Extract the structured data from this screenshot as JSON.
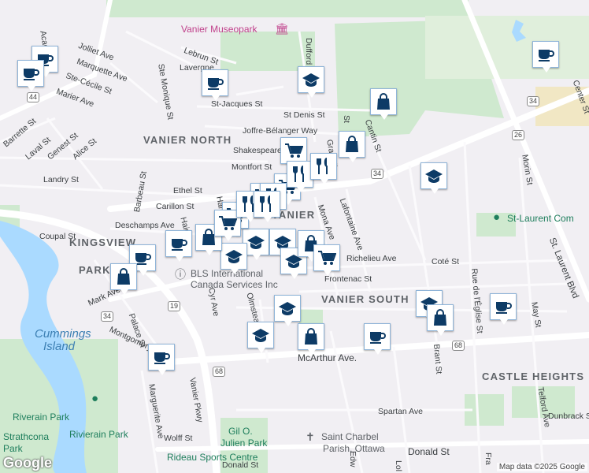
{
  "attribution": {
    "logo": "Google",
    "text": "Map data ©2025 Google"
  },
  "areas": [
    "VANIER NORTH",
    "VANIER",
    "KINGSVIEW",
    "PARK",
    "VANIER SOUTH",
    "CASTLE HEIGHTS"
  ],
  "water_labels": [
    "Cummings",
    "Island"
  ],
  "pois": [
    {
      "name": "Vanier Museopark",
      "color": "#c0418b"
    },
    {
      "name": "St-Laurent Com",
      "color": "#1e7e5c"
    },
    {
      "name": "Riverain Park",
      "color": "#1e7e5c"
    },
    {
      "name": "Rivierain Park",
      "color": "#1e7e5c"
    },
    {
      "name": "Strathcona",
      "color": "#1e7e5c"
    },
    {
      "name": "Park",
      "color": "#1e7e5c"
    },
    {
      "name": "Rideau Sports Centre",
      "color": "#1e7e5c"
    },
    {
      "name": "Gil O.",
      "color": "#1e7e5c"
    },
    {
      "name": "Julien Park",
      "color": "#1e7e5c"
    },
    {
      "name": "Saint Charbel",
      "color": "#5f6368"
    },
    {
      "name": "Parish, Ottawa",
      "color": "#5f6368"
    },
    {
      "name": "BLS International",
      "color": "#5f6368"
    },
    {
      "name": "Canada Services Inc",
      "color": "#5f6368"
    }
  ],
  "streets": [
    "Jolliet Ave",
    "Marquette Ave",
    "Ste-Cécile St",
    "Marier Ave",
    "Barrette St",
    "Laval St",
    "Genest St",
    "Alice St",
    "Landry St",
    "Barbeau St",
    "Ethel St",
    "Carillon St",
    "Deschamps Ave",
    "Coupal St",
    "Mark Ave",
    "Palace St",
    "Montgomery",
    "Marguerite Ave",
    "Wolff St",
    "Vanier Pkwy",
    "Cyr Ave",
    "Olmstead",
    "McArthur Ave.",
    "Spartan Ave",
    "Donald St",
    "Donald St",
    "Lebrun St",
    "Lavergne",
    "St-Jacques St",
    "St Denis St",
    "Joffre-Bélanger Way",
    "Shakespeare",
    "Montfort St",
    "Mona Ave",
    "Lafontaine Ave",
    "Cantin St",
    "Richelieu Ave",
    "Frontenac St",
    "Coté St",
    "Brant St",
    "Rue de l'Église St",
    "Telford Ave",
    "Dunbrack St",
    "May St",
    "Morin St",
    "St. Laurent Blvd",
    "Center St",
    "Ste Monique St",
    "Acad",
    "Granville",
    "Dufford St",
    "Haig",
    "Hannah",
    "St",
    "Edw",
    "Lol",
    "Fra"
  ],
  "route_shields": [
    "44",
    "34",
    "34",
    "26",
    "19",
    "34",
    "68",
    "68"
  ],
  "markers": [
    {
      "icon": "cafe"
    },
    {
      "icon": "cafe"
    },
    {
      "icon": "cafe"
    },
    {
      "icon": "cafe"
    },
    {
      "icon": "cafe"
    },
    {
      "icon": "cafe"
    },
    {
      "icon": "cafe"
    },
    {
      "icon": "cafe"
    },
    {
      "icon": "cafe"
    },
    {
      "icon": "school"
    },
    {
      "icon": "school"
    },
    {
      "icon": "school"
    },
    {
      "icon": "school"
    },
    {
      "icon": "school"
    },
    {
      "icon": "school"
    },
    {
      "icon": "school"
    },
    {
      "icon": "school"
    },
    {
      "icon": "school"
    },
    {
      "icon": "shopping"
    },
    {
      "icon": "shopping"
    },
    {
      "icon": "shopping"
    },
    {
      "icon": "shopping"
    },
    {
      "icon": "shopping"
    },
    {
      "icon": "shopping"
    },
    {
      "icon": "shopping"
    },
    {
      "icon": "grocery"
    },
    {
      "icon": "grocery"
    },
    {
      "icon": "grocery"
    },
    {
      "icon": "grocery"
    },
    {
      "icon": "grocery"
    },
    {
      "icon": "grocery"
    },
    {
      "icon": "restaurant"
    },
    {
      "icon": "restaurant"
    },
    {
      "icon": "restaurant"
    },
    {
      "icon": "restaurant"
    },
    {
      "icon": "restaurant"
    }
  ]
}
